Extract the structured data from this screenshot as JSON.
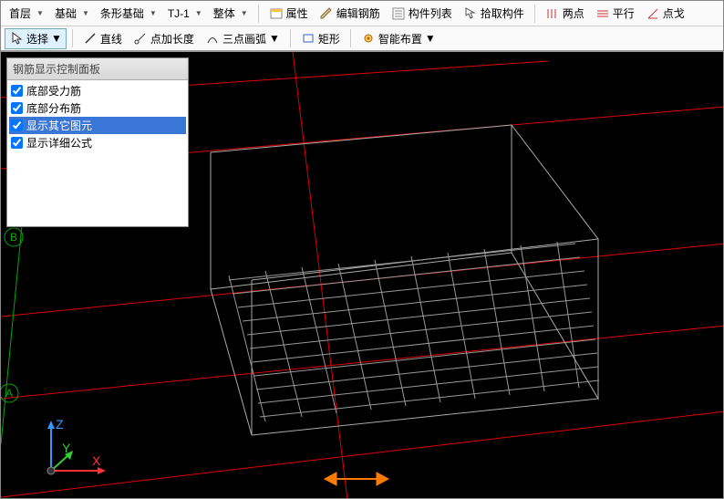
{
  "toolbar1": {
    "layer": "首层",
    "basis": "基础",
    "stripBasis": "条形基础",
    "code": "TJ-1",
    "whole": "整体",
    "attr": "属性",
    "editRebar": "编辑钢筋",
    "componentList": "构件列表",
    "pickComponent": "拾取构件",
    "twoPoint": "两点",
    "parallel": "平行",
    "pointAngle": "点戈"
  },
  "toolbar2": {
    "select": "选择",
    "line": "直线",
    "pointLength": "点加长度",
    "threePointArc": "三点画弧",
    "rect": "矩形",
    "smartLayout": "智能布置"
  },
  "panel": {
    "title": "钢筋显示控制面板",
    "items": [
      {
        "label": "底部受力筋",
        "checked": true,
        "selected": false
      },
      {
        "label": "底部分布筋",
        "checked": true,
        "selected": false
      },
      {
        "label": "显示其它图元",
        "checked": true,
        "selected": true
      },
      {
        "label": "显示详细公式",
        "checked": true,
        "selected": false
      }
    ]
  },
  "axis": {
    "x": "X",
    "y": "Y",
    "z": "Z"
  },
  "markers": {
    "a": "A",
    "b": "B"
  }
}
